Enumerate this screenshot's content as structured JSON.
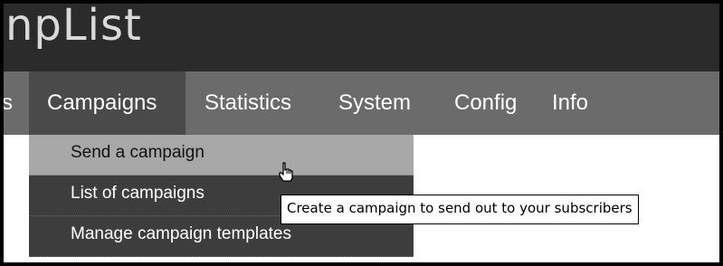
{
  "app": {
    "logo_text": "npList"
  },
  "nav": {
    "items": [
      {
        "label": "s"
      },
      {
        "label": "Campaigns"
      },
      {
        "label": "Statistics"
      },
      {
        "label": "System"
      },
      {
        "label": "Config"
      },
      {
        "label": "Info"
      }
    ],
    "active": "Campaigns"
  },
  "dropdown": {
    "items": [
      {
        "label": "Send a campaign"
      },
      {
        "label": "List of campaigns"
      },
      {
        "label": "Manage campaign templates"
      }
    ],
    "hovered": "Send a campaign"
  },
  "tooltip": {
    "text": "Create a campaign to send out to your subscribers"
  },
  "colors": {
    "header_bg": "#2b2b2b",
    "nav_bg": "#6b6b6b",
    "nav_active_bg": "#4a4a4a",
    "dropdown_bg": "#3d3d3d",
    "dropdown_hover_bg": "#a8a8a8"
  },
  "icons": {
    "cursor": "hand-pointer-icon"
  }
}
